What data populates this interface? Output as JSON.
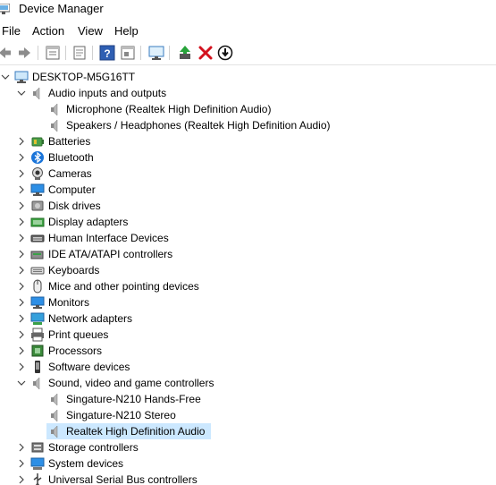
{
  "window": {
    "title": "Device Manager"
  },
  "menu": [
    "File",
    "Action",
    "View",
    "Help"
  ],
  "toolbar": [
    "back-icon",
    "forward-icon",
    "properties-pane-icon",
    "properties-icon",
    "help-icon",
    "view-pane-icon",
    "monitor-scan-icon",
    "update-driver-icon",
    "uninstall-icon",
    "disable-device-icon"
  ],
  "tree": {
    "root": "DESKTOP-M5G16TT",
    "audio_io": {
      "label": "Audio inputs and outputs",
      "children": [
        "Microphone (Realtek High Definition Audio)",
        "Speakers / Headphones (Realtek High Definition Audio)"
      ]
    },
    "categories_a": [
      "Batteries",
      "Bluetooth",
      "Cameras",
      "Computer",
      "Disk drives",
      "Display adapters",
      "Human Interface Devices",
      "IDE ATA/ATAPI controllers",
      "Keyboards",
      "Mice and other pointing devices",
      "Monitors",
      "Network adapters",
      "Print queues",
      "Processors",
      "Software devices"
    ],
    "sound": {
      "label": "Sound, video and game controllers",
      "children": [
        "Singature-N210 Hands-Free",
        "Singature-N210 Stereo",
        "Realtek High Definition Audio"
      ],
      "selected_index": 2
    },
    "categories_b": [
      "Storage controllers",
      "System devices",
      "Universal Serial Bus controllers"
    ]
  }
}
